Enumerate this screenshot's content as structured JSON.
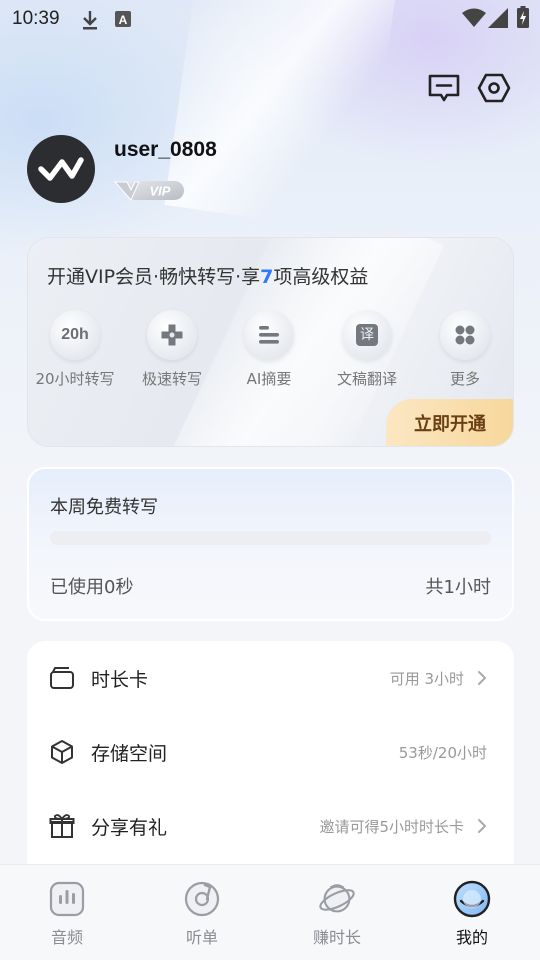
{
  "status_bar": {
    "time": "10:39",
    "icons": [
      "download-icon",
      "a-notification-icon",
      "wifi-icon",
      "signal-icon",
      "battery-icon"
    ]
  },
  "header": {
    "icons": [
      "message-icon",
      "settings-hexagon-icon"
    ]
  },
  "profile": {
    "username": "user_0808",
    "badge": "VIP"
  },
  "vip_card": {
    "title_before": "开通VIP会员·畅快转写·享",
    "title_highlight": "7",
    "title_after": "项高级权益",
    "perks": [
      {
        "icon_text": "20h",
        "label": "20小时转写",
        "icon": "hours-icon"
      },
      {
        "icon_text": "",
        "label": "极速转写",
        "icon": "speed-plus-icon"
      },
      {
        "icon_text": "",
        "label": "AI摘要",
        "icon": "summary-lines-icon"
      },
      {
        "icon_text": "译",
        "label": "文稿翻译",
        "icon": "translate-icon"
      },
      {
        "icon_text": "",
        "label": "更多",
        "icon": "more-grid-icon"
      }
    ],
    "open_button": "立即开通",
    "highlight_color": "#2f7bf6"
  },
  "free_card": {
    "title": "本周免费转写",
    "used": "已使用0秒",
    "total": "共1小时",
    "progress": 0
  },
  "list": [
    {
      "label": "时长卡",
      "value": "可用 3小时",
      "icon": "card-icon",
      "arrow": true
    },
    {
      "label": "存储空间",
      "value": "53秒/20小时",
      "icon": "box-icon",
      "arrow": false
    },
    {
      "label": "分享有礼",
      "value": "邀请可得5小时时长卡",
      "icon": "gift-icon",
      "arrow": true
    }
  ],
  "bottom_nav": [
    {
      "label": "音频",
      "icon": "audio-icon",
      "active": false
    },
    {
      "label": "听单",
      "icon": "playlist-disc-icon",
      "active": false
    },
    {
      "label": "赚时长",
      "icon": "planet-icon",
      "active": false
    },
    {
      "label": "我的",
      "icon": "profile-face-icon",
      "active": true
    }
  ]
}
